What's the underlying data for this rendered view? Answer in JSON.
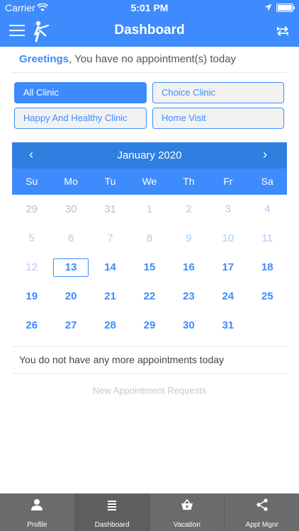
{
  "status_bar": {
    "carrier": "Carrier",
    "time": "5:01 PM"
  },
  "navbar": {
    "title": "Dashboard"
  },
  "greeting": {
    "highlight": "Greetings",
    "message": ", You have no appointment(s) today"
  },
  "clinics": [
    {
      "label": "All Clinic",
      "active": true
    },
    {
      "label": "Choice Clinic",
      "active": false
    },
    {
      "label": "Happy And Healthy Clinic",
      "active": false
    },
    {
      "label": "Home Visit",
      "active": false
    }
  ],
  "calendar": {
    "month_label": "January 2020",
    "prev": "‹",
    "next": "›",
    "weekdays": [
      "Su",
      "Mo",
      "Tu",
      "We",
      "Th",
      "Fr",
      "Sa"
    ],
    "rows": [
      [
        "29",
        "30",
        "31",
        "1",
        "2",
        "3",
        "4"
      ],
      [
        "5",
        "6",
        "7",
        "8",
        "9",
        "10",
        "11"
      ],
      [
        "12",
        "13",
        "14",
        "15",
        "16",
        "17",
        "18"
      ],
      [
        "19",
        "20",
        "21",
        "22",
        "23",
        "24",
        "25"
      ],
      [
        "26",
        "27",
        "28",
        "29",
        "30",
        "31",
        ""
      ]
    ],
    "today": "13"
  },
  "no_appointments": "You do not have any more appointments today",
  "new_requests": "New Appointment Requests",
  "tabs": [
    {
      "label": "Profile",
      "icon": "person-icon"
    },
    {
      "label": "Dashboard",
      "icon": "list-icon"
    },
    {
      "label": "Vacation",
      "icon": "basket-icon"
    },
    {
      "label": "Appt Mgnr",
      "icon": "share-icon"
    }
  ],
  "colors": {
    "primary": "#3d8bfd",
    "header_dark": "#2f7fe0",
    "tabbar": "#6b6b6b"
  }
}
